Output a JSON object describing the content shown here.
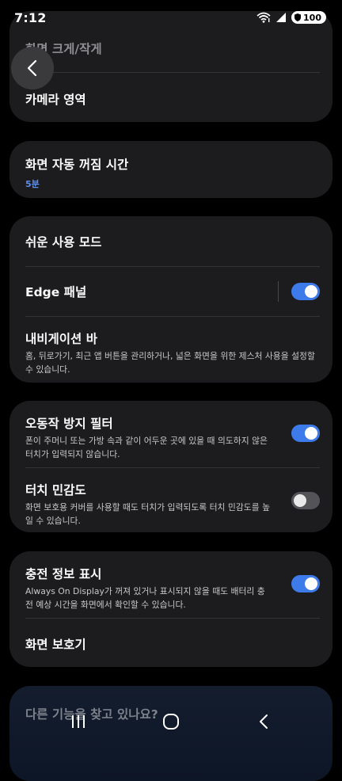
{
  "status": {
    "time": "7:12",
    "battery": "100"
  },
  "cards": {
    "display_size": {
      "label": "화면 크게/작게"
    },
    "camera_area": {
      "label": "카메라 영역"
    },
    "screen_timeout": {
      "label": "화면 자동 꺼짐 시간",
      "value": "5분"
    },
    "easy_mode": {
      "label": "쉬운 사용 모드"
    },
    "edge_panels": {
      "label": "Edge 패널",
      "on": true
    },
    "navigation_bar": {
      "label": "내비게이션 바",
      "description": "홈, 뒤로가기, 최근 앱 버튼을 관리하거나, 넓은 화면을 위한 제스처 사용을 설정할 수 있습니다."
    },
    "accidental_touch": {
      "label": "오동작 방지 필터",
      "description": "폰이 주머니 또는 가방 속과 같이 어두운 곳에 있을 때 의도하지 않은 터치가 입력되지 않습니다.",
      "on": true
    },
    "touch_sensitivity": {
      "label": "터치 민감도",
      "description": "화면 보호용 커버를 사용할 때도 터치가 입력되도록 터치 민감도를 높일 수 있습니다.",
      "on": false
    },
    "charging_info": {
      "label": "충전 정보 표시",
      "description": "Always On Display가 꺼져 있거나 표시되지 않을 때도 배터리 충전 예상 시간을 화면에서 확인할 수 있습니다.",
      "on": true
    },
    "screen_saver": {
      "label": "화면 보호기"
    }
  },
  "bottom": {
    "title": "다른 기능을 찾고 있나요?"
  },
  "colors": {
    "accent": "#3e7bea",
    "value_blue": "#5b8def",
    "card_bg": "#1c1c1e"
  }
}
